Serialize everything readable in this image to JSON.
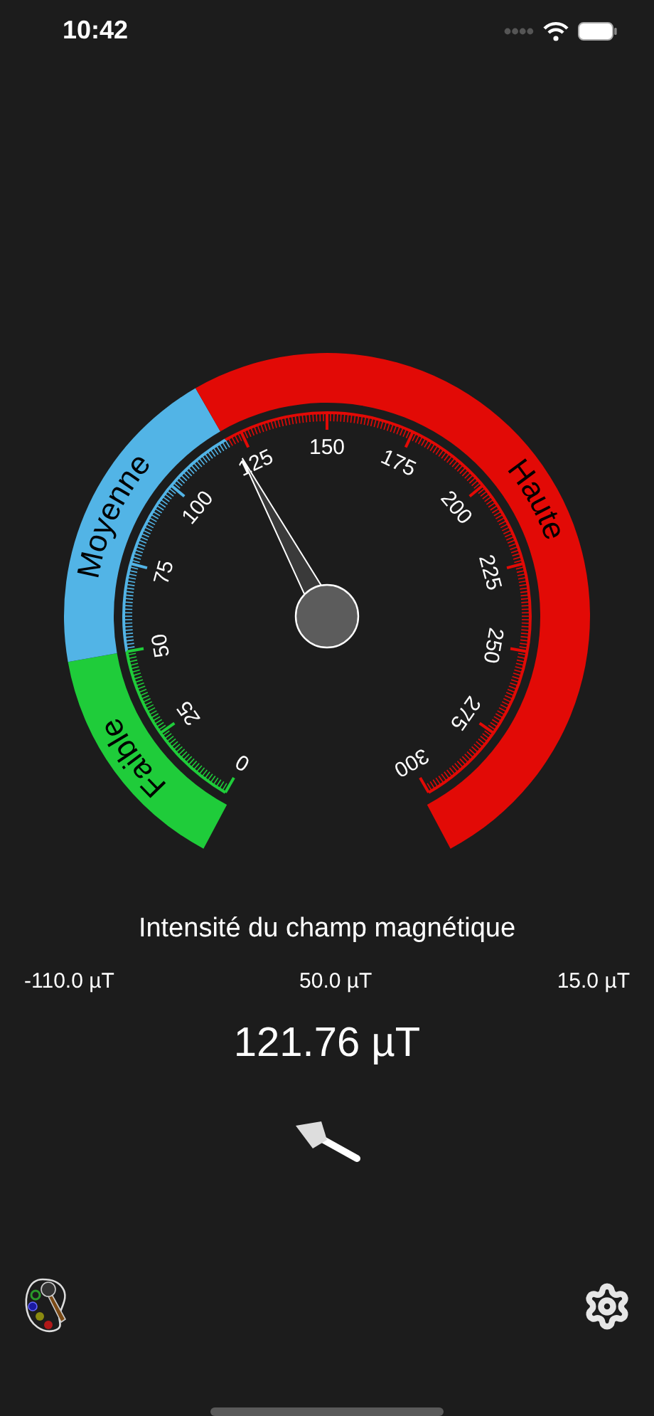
{
  "status_bar": {
    "time": "10:42"
  },
  "gauge": {
    "scale_labels": [
      "0",
      "25",
      "50",
      "75",
      "100",
      "125",
      "150",
      "175",
      "200",
      "225",
      "250",
      "275",
      "300"
    ],
    "zones": [
      {
        "label": "Faible",
        "color": "#1fcc3a"
      },
      {
        "label": "Moyenne",
        "color": "#52b4e6"
      },
      {
        "label": "Haute",
        "color": "#e20a06"
      }
    ]
  },
  "title": "Intensité du champ magnétique",
  "readings": [
    "-110.0 µT",
    "50.0 µT",
    "15.0 µT"
  ],
  "total": "121.76 µT"
}
